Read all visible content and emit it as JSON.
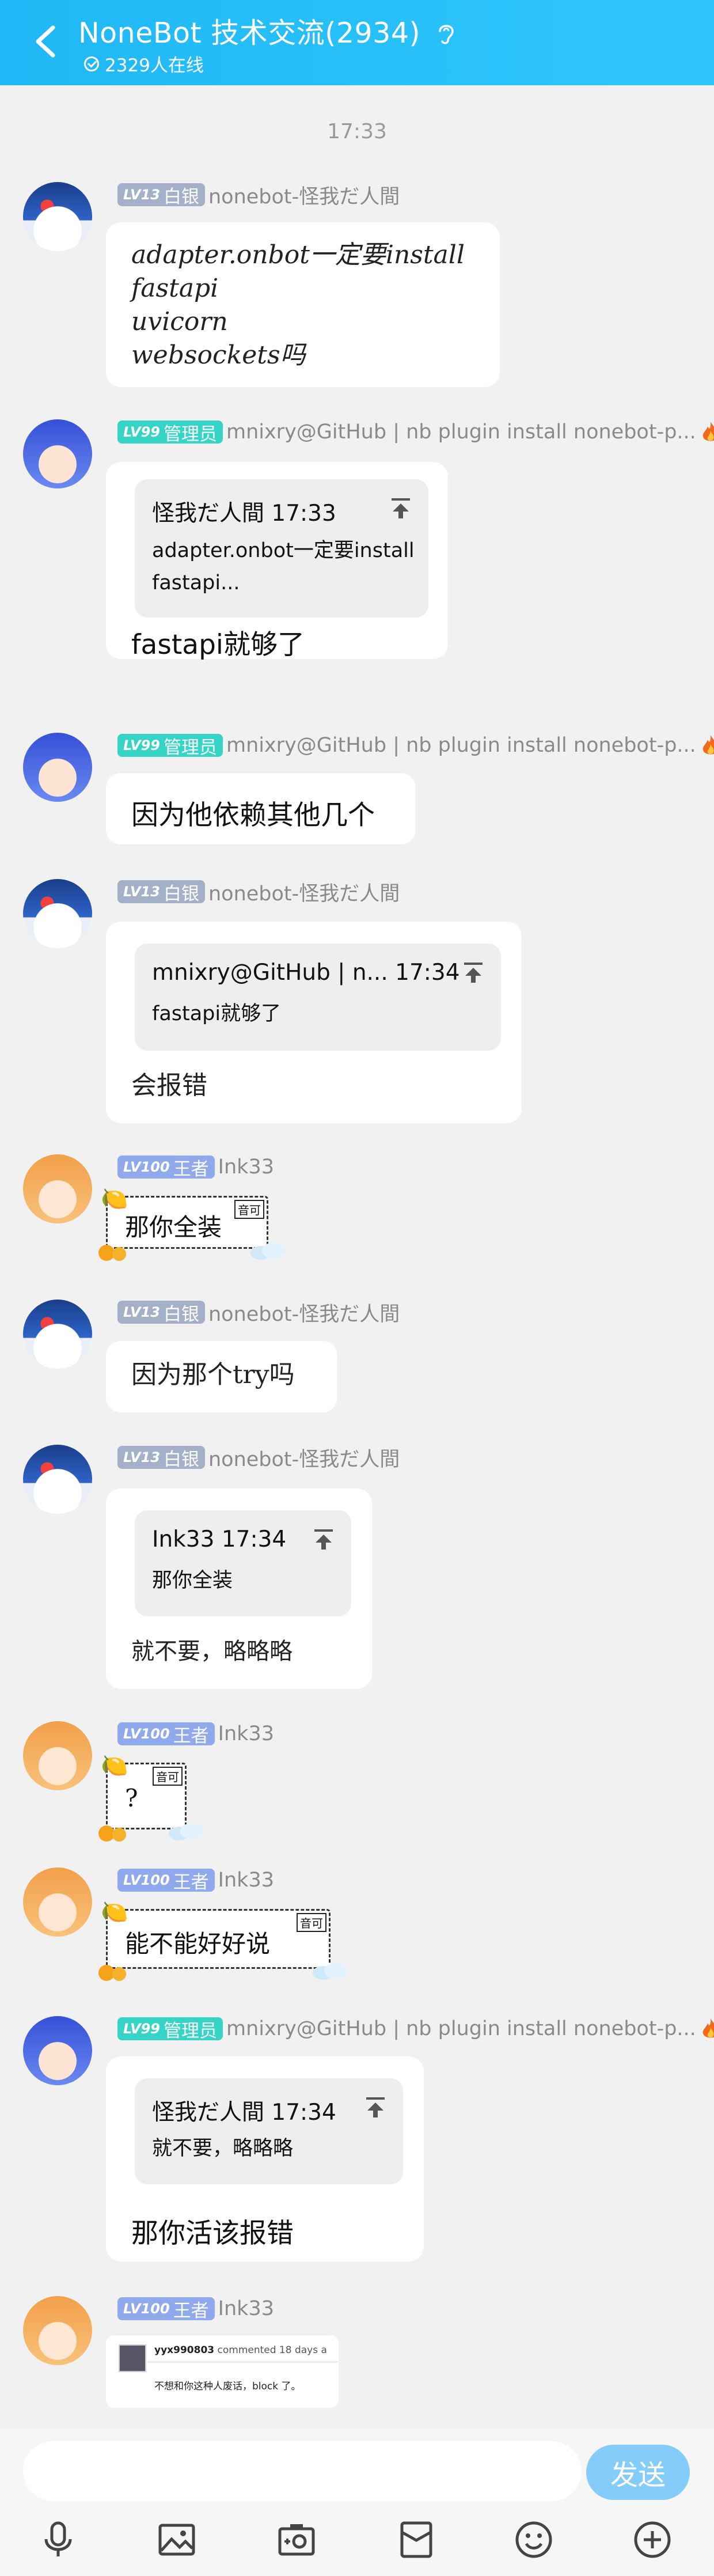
{
  "header": {
    "title": "NoneBot 技术交流(2934)",
    "online": "2329人在线"
  },
  "time_label": "17:33",
  "badges": {
    "lv13": "LV13",
    "lv99": "LV99",
    "lv100": "LV100",
    "silver": "白银",
    "admin": "管理员",
    "king": "王者"
  },
  "names": {
    "nonebot": "nonebot-怪我だ人間",
    "mnixry": "mnixry@GitHub | nb plugin install nonebot-p...",
    "ink": "Ink33"
  },
  "messages": {
    "m1": {
      "lines": [
        "adapter.onbot一定要install",
        "fastapi",
        "uvicorn",
        "websockets吗"
      ]
    },
    "m2": {
      "quote_author": "怪我だ人間 17:33",
      "quote_lines": [
        "adapter.onbot一定要install",
        "fastapi..."
      ],
      "text": "fastapi就够了"
    },
    "m3": {
      "text": "因为他依赖其他几个"
    },
    "m4": {
      "quote_author": "mnixry@GitHub | n... 17:34",
      "quote_lines": [
        "fastapi就够了"
      ],
      "text": "会报错"
    },
    "m5": {
      "text": "那你全装",
      "tag": "音可"
    },
    "m6": {
      "text": "因为那个try吗"
    },
    "m7": {
      "quote_author": "Ink33 17:34",
      "quote_lines": [
        "那你全装"
      ],
      "text": "就不要，略略略"
    },
    "m8": {
      "text": "?",
      "tag": "音可"
    },
    "m9": {
      "text": "能不能好好说",
      "tag": "音可"
    },
    "m10": {
      "quote_author": "怪我だ人間 17:34",
      "quote_lines": [
        "就不要，略略略"
      ],
      "text": "那你活该报错"
    },
    "m11": {
      "user": "yyx990803",
      "action": "commented 18 days a",
      "text": "不想和你这种人废话，block 了。"
    }
  },
  "input": {
    "send_label": "发送"
  },
  "toolbar": {
    "icons": [
      "microphone-icon",
      "image-icon",
      "camera-icon",
      "redpacket-icon",
      "emoji-icon",
      "plus-icon"
    ]
  }
}
